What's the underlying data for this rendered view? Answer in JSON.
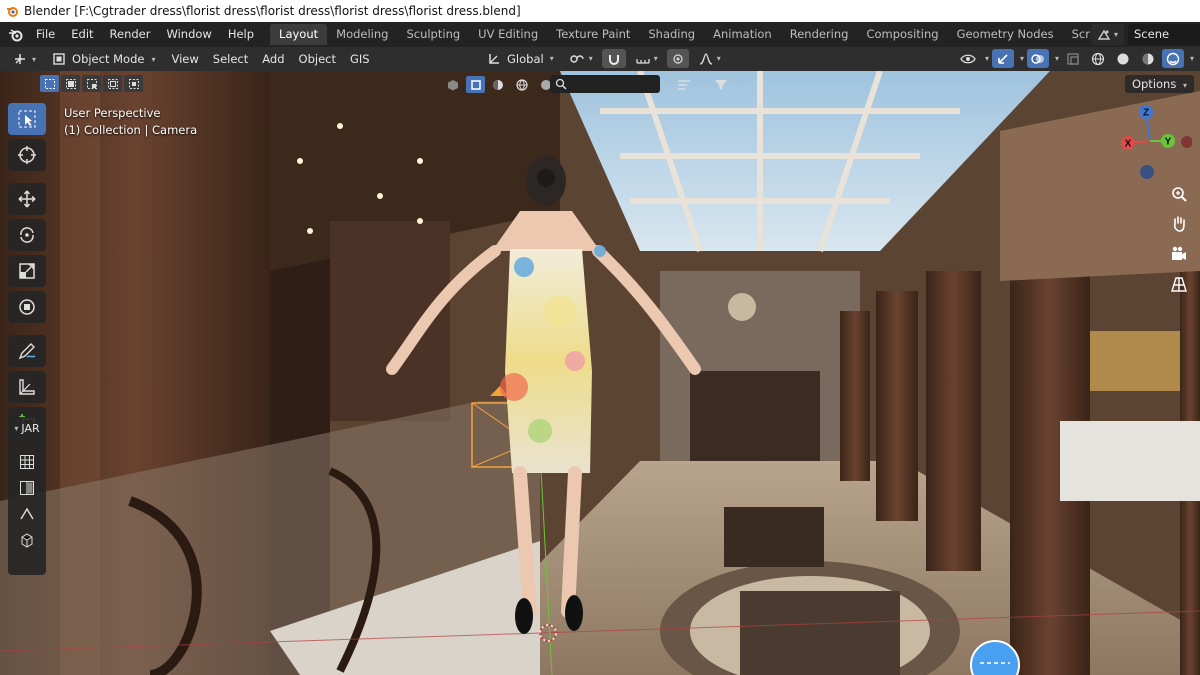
{
  "window": {
    "title": "Blender [F:\\Cgtrader dress\\florist dress\\florist dress\\florist dress\\florist dress.blend]"
  },
  "topmenu": {
    "items": [
      "File",
      "Edit",
      "Render",
      "Window",
      "Help"
    ]
  },
  "workspaces": {
    "tabs": [
      "Layout",
      "Modeling",
      "Sculpting",
      "UV Editing",
      "Texture Paint",
      "Shading",
      "Animation",
      "Rendering",
      "Compositing",
      "Geometry Nodes",
      "Scripting"
    ],
    "active": "Layout",
    "add_label": "+"
  },
  "scene": {
    "name": "Scene"
  },
  "header": {
    "mode": "Object Mode",
    "menus": [
      "View",
      "Select",
      "Add",
      "Object",
      "GIS"
    ],
    "transform_orientation": "Global"
  },
  "viewport": {
    "perspective": "User Perspective",
    "collection": "(1) Collection | Camera",
    "options_label": "Options",
    "search_placeholder": ""
  },
  "panel": {
    "jar_label": "JAR"
  },
  "gizmo": {
    "z": "Z",
    "x": "X",
    "y": "Y"
  },
  "colors": {
    "accent": "#4772b3",
    "x_axis": "#e04a4a",
    "y_axis": "#6ac43a",
    "z_axis": "#3f77d6"
  }
}
